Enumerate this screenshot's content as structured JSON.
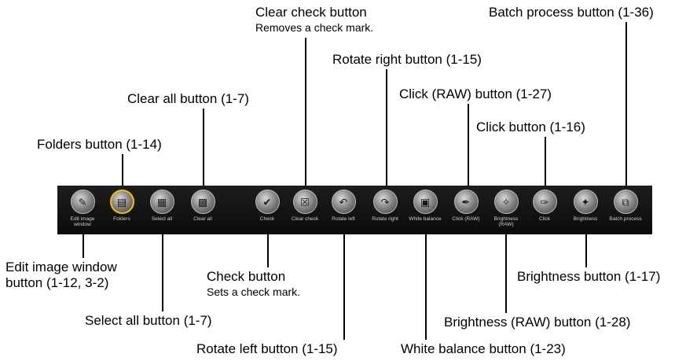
{
  "toolbar": {
    "buttons": [
      {
        "label": "Edit image window",
        "icon": "edit-image-icon",
        "glyph": "✎"
      },
      {
        "label": "Folders",
        "icon": "folders-icon",
        "glyph": "▤"
      },
      {
        "label": "Select all",
        "icon": "select-all-icon",
        "glyph": "▦"
      },
      {
        "label": "Clear all",
        "icon": "clear-all-icon",
        "glyph": "▩"
      },
      {
        "label": "Check",
        "icon": "check-icon",
        "glyph": "✔"
      },
      {
        "label": "Clear check",
        "icon": "clear-check-icon",
        "glyph": "☒"
      },
      {
        "label": "Rotate left",
        "icon": "rotate-left-icon",
        "glyph": "↶"
      },
      {
        "label": "Rotate right",
        "icon": "rotate-right-icon",
        "glyph": "↷"
      },
      {
        "label": "White balance",
        "icon": "white-balance-icon",
        "glyph": "▣"
      },
      {
        "label": "Click (RAW)",
        "icon": "click-raw-icon",
        "glyph": "✒"
      },
      {
        "label": "Brightness (RAW)",
        "icon": "brightness-raw-icon",
        "glyph": "✧"
      },
      {
        "label": "Click",
        "icon": "click-icon",
        "glyph": "✑"
      },
      {
        "label": "Brightness",
        "icon": "brightness-icon",
        "glyph": "✦"
      },
      {
        "label": "Batch process",
        "icon": "batch-process-icon",
        "glyph": "⧉"
      }
    ]
  },
  "callouts": {
    "clear_check": "Clear check button",
    "clear_check_desc": "Removes a check mark.",
    "batch_process": "Batch process button (1-36)",
    "rotate_right": "Rotate right button (1-15)",
    "clear_all": "Clear all button (1-7)",
    "click_raw": "Click (RAW) button (1-27)",
    "click": "Click button (1-16)",
    "folders": "Folders button (1-14)",
    "edit_image_window_1": "Edit image window",
    "edit_image_window_2": "button (1-12, 3-2)",
    "check": "Check button",
    "check_desc": "Sets a check mark.",
    "brightness": "Brightness button (1-17)",
    "select_all": "Select all button (1-7)",
    "brightness_raw": "Brightness (RAW) button (1-28)",
    "rotate_left": "Rotate left button (1-15)",
    "white_balance": "White balance button (1-23)"
  },
  "colors": {
    "toolbar_bg": "#141313",
    "folder_ring": "#f0c000",
    "text": "#000000"
  }
}
